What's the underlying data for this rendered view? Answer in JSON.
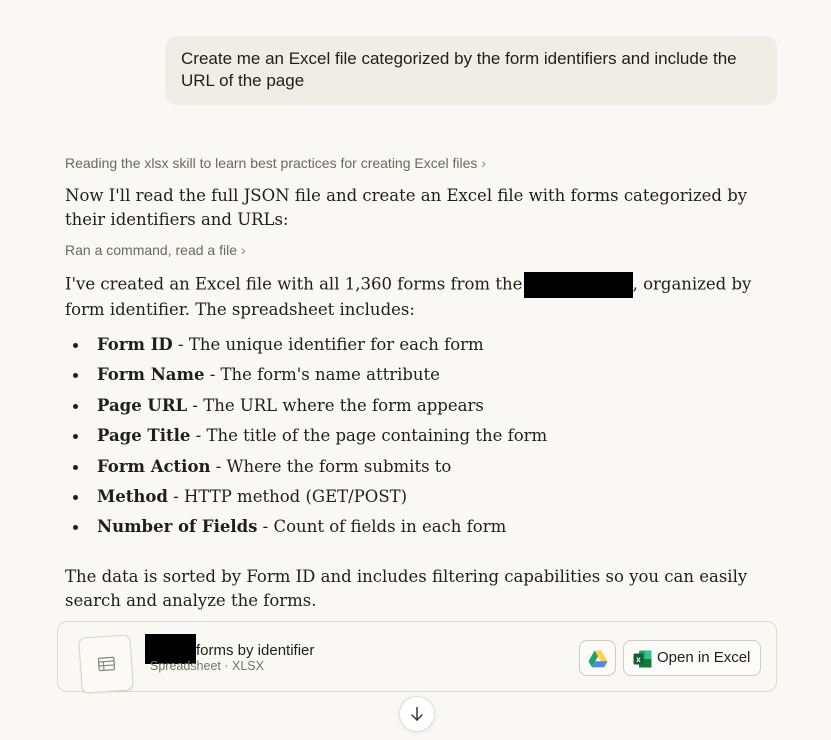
{
  "user_message": {
    "text": "Create me an Excel file categorized by the form identifiers and include the URL of the page"
  },
  "assistant": {
    "step1_label": "Reading the xlsx skill to learn best practices for creating Excel files",
    "intro": "Now I'll read the full JSON file and create an Excel file with forms categorized by their identifiers and URLs:",
    "step2_label": "Ran a command, read a file",
    "summary_before": "I've created an Excel file with all 1,360 forms from the ",
    "summary_after": ", organized by form identifier. The spreadsheet includes:",
    "features": [
      {
        "name": "Form ID",
        "desc": " - The unique identifier for each form"
      },
      {
        "name": "Form Name",
        "desc": " - The form's name attribute"
      },
      {
        "name": "Page URL",
        "desc": " - The URL where the form appears"
      },
      {
        "name": "Page Title",
        "desc": " - The title of the page containing the form"
      },
      {
        "name": "Form Action",
        "desc": " - Where the form submits to"
      },
      {
        "name": "Method",
        "desc": " - HTTP method (GET/POST)"
      },
      {
        "name": "Number of Fields",
        "desc": " - Count of fields in each form"
      }
    ],
    "closing": "The data is sorted by Form ID and includes filtering capabilities so you can easily search and analyze the forms."
  },
  "artifact": {
    "title_suffix": "forms by identifier",
    "meta": "Spreadsheet · XLSX",
    "open_label": "Open in Excel",
    "file_icon": "spreadsheet-icon",
    "drive_icon": "google-drive-icon",
    "excel_icon": "excel-icon"
  },
  "scroll_icon": "arrow-down-icon",
  "colors": {
    "background": "#f9f8f5",
    "user_bubble": "#efede6",
    "excel_green": "#107c41",
    "drive_green": "#1fa463",
    "drive_yellow": "#ffd04b",
    "drive_blue": "#4688f4"
  }
}
